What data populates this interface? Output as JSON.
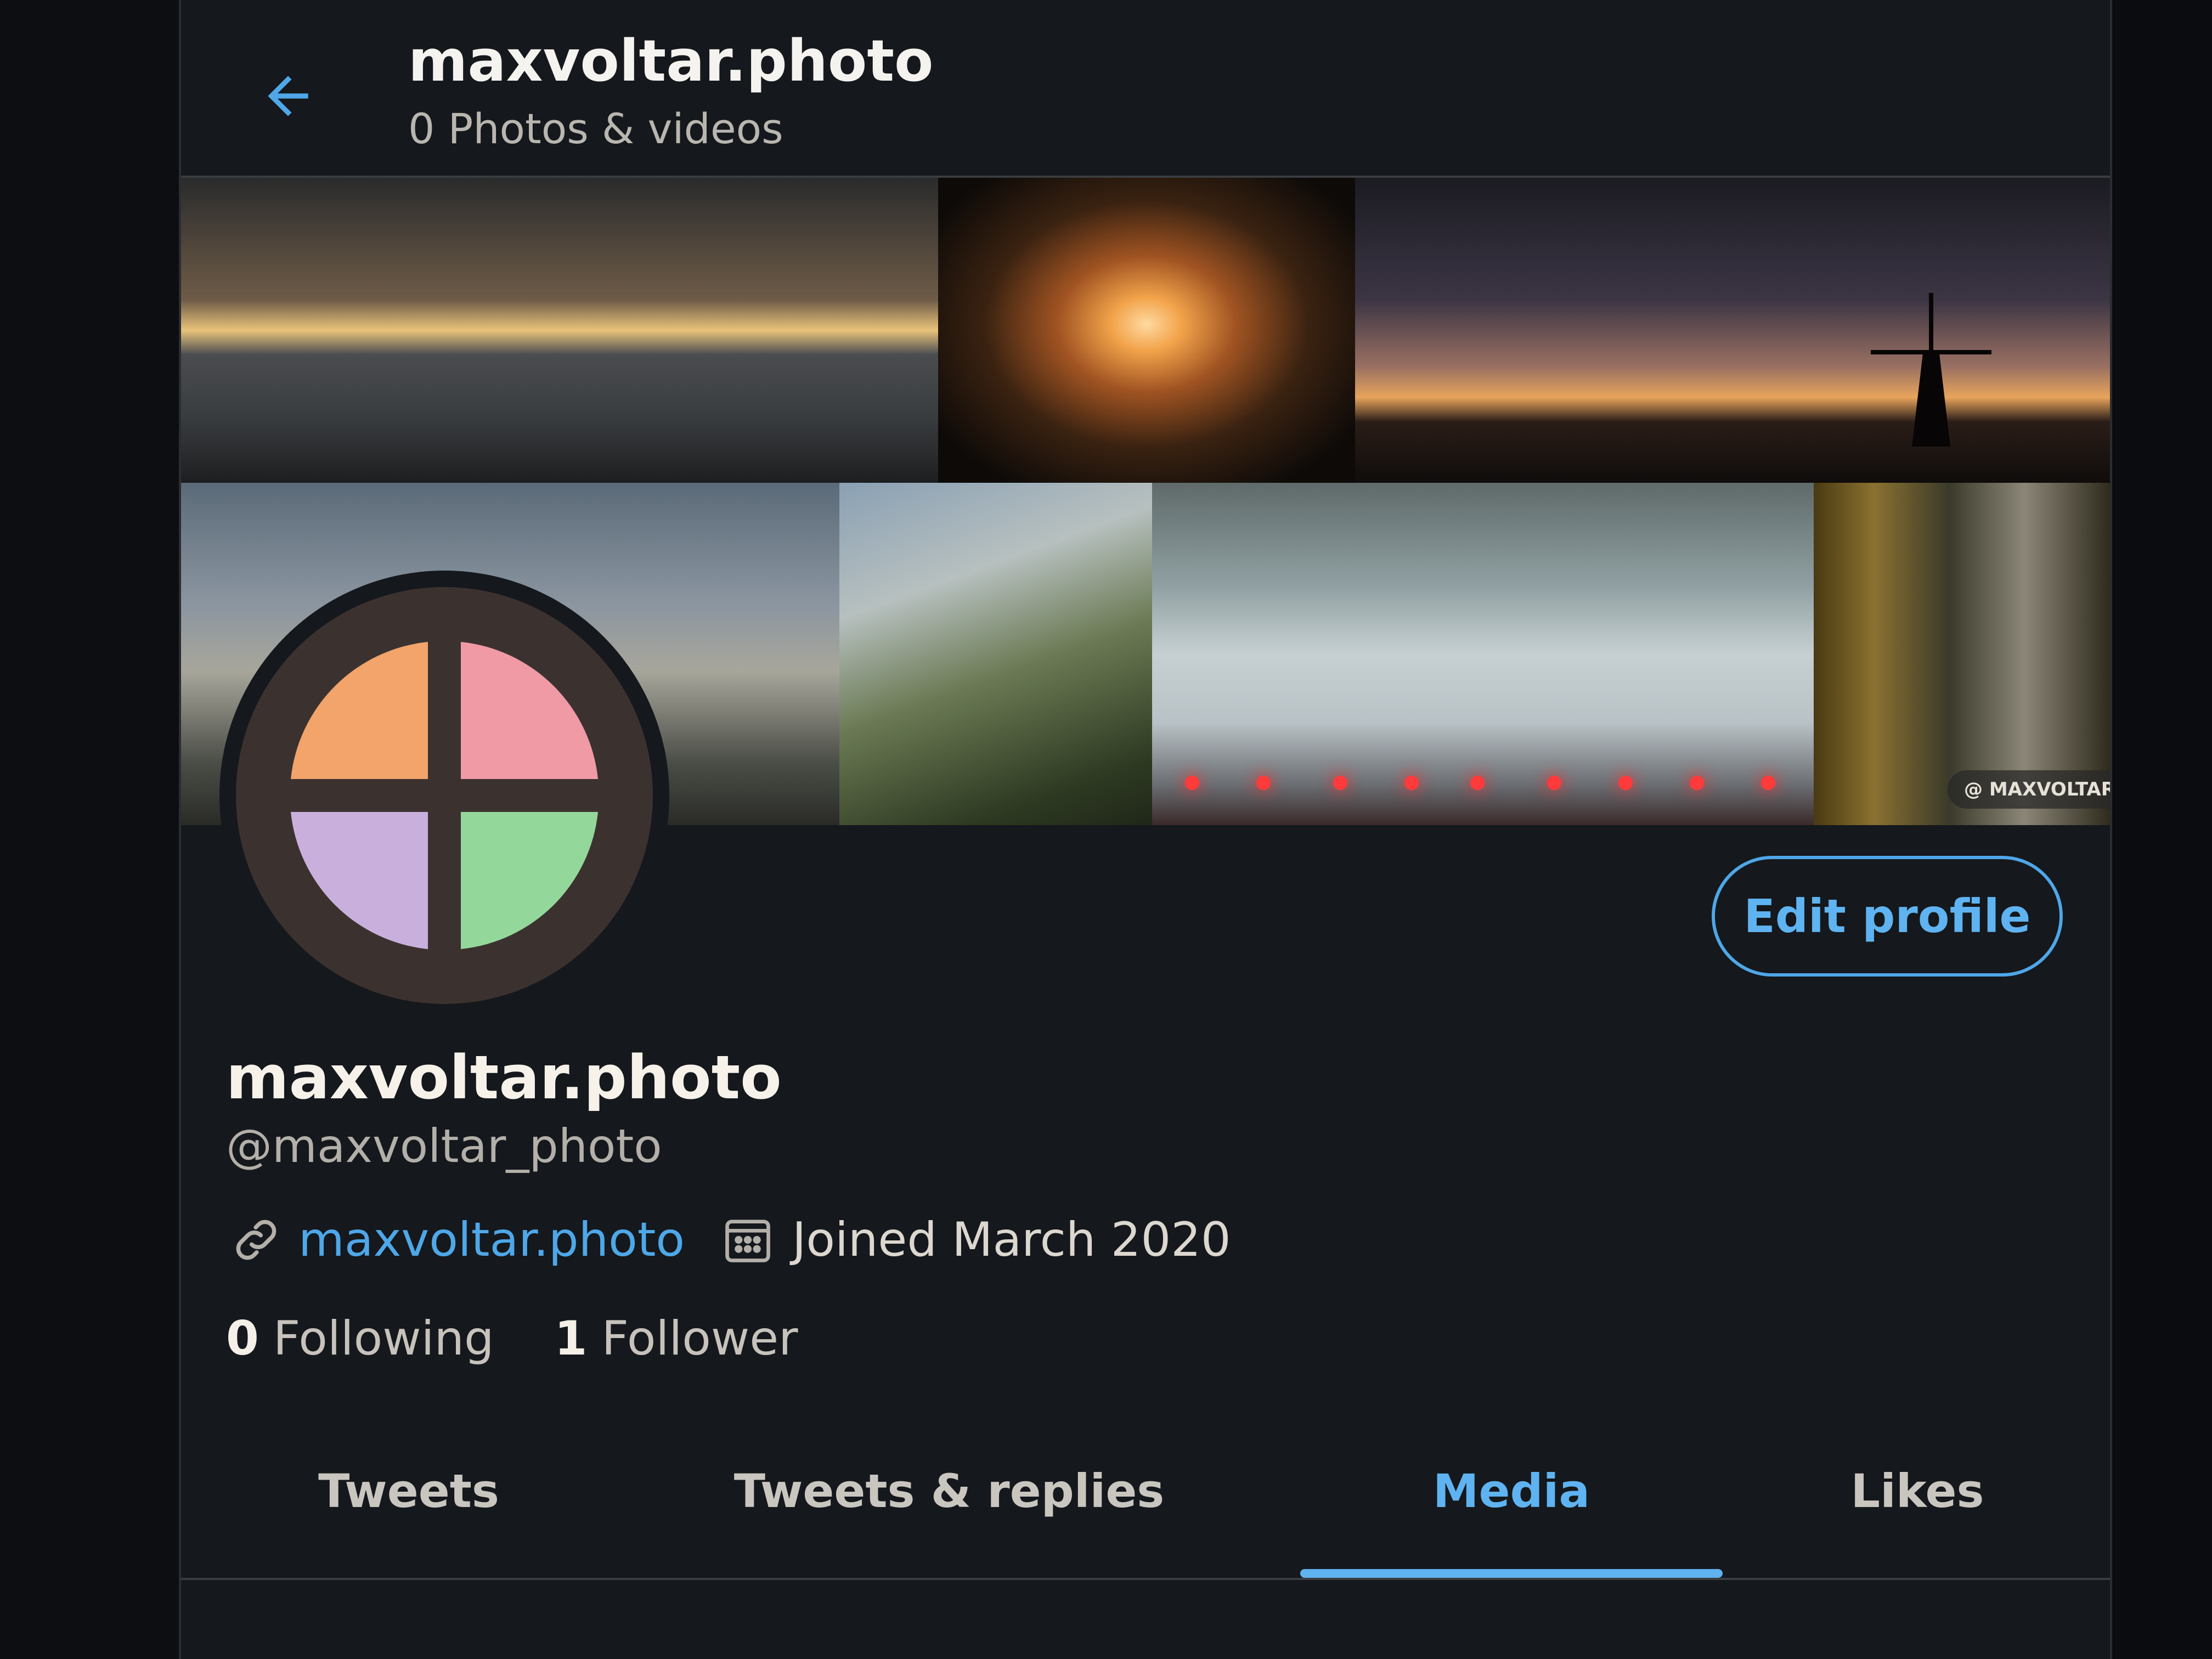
{
  "header": {
    "title": "maxvoltar.photo",
    "subtitle": "0 Photos & videos"
  },
  "banner": {
    "watermark": "@ MAXVOLTAR"
  },
  "profile": {
    "display_name": "maxvoltar.photo",
    "handle": "@maxvoltar_photo",
    "website": "maxvoltar.photo",
    "joined": "Joined March 2020",
    "following_count": "0",
    "following_label": "Following",
    "followers_count": "1",
    "followers_label": "Follower",
    "edit_button": "Edit profile"
  },
  "tabs": [
    {
      "label": "Tweets"
    },
    {
      "label": "Tweets & replies"
    },
    {
      "label": "Media"
    },
    {
      "label": "Likes"
    }
  ],
  "colors": {
    "accent": "#5eb3f0",
    "background": "#15181c",
    "avatar_orange": "#f2a46a",
    "avatar_pink": "#f09aa6",
    "avatar_lavender": "#c9b0dc",
    "avatar_green": "#93d89a"
  },
  "icons": {
    "back": "arrow-left-icon",
    "link": "link-icon",
    "calendar": "calendar-icon"
  }
}
